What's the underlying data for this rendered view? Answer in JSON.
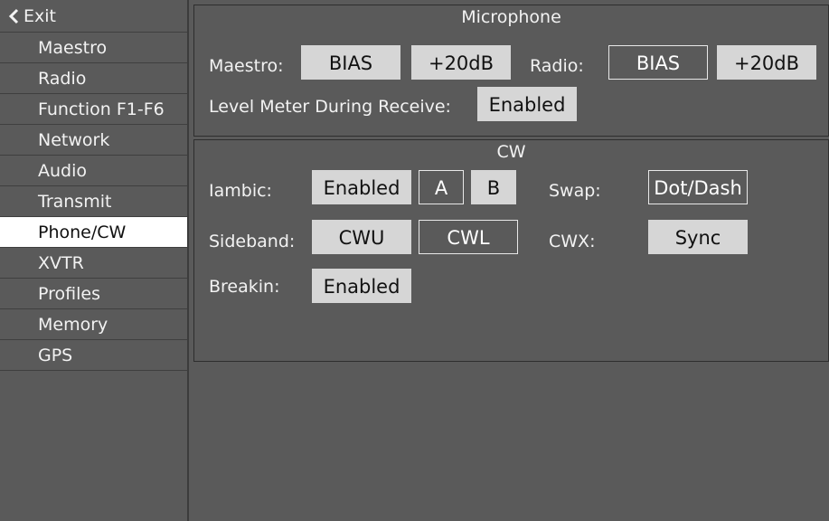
{
  "sidebar": {
    "exit_label": "Exit",
    "items": [
      {
        "label": "Maestro"
      },
      {
        "label": "Radio"
      },
      {
        "label": "Function F1-F6"
      },
      {
        "label": "Network"
      },
      {
        "label": "Audio"
      },
      {
        "label": "Transmit"
      },
      {
        "label": "Phone/CW"
      },
      {
        "label": "XVTR"
      },
      {
        "label": "Profiles"
      },
      {
        "label": "Memory"
      },
      {
        "label": "GPS"
      }
    ],
    "active": "Phone/CW"
  },
  "microphone": {
    "title": "Microphone",
    "maestro_label": "Maestro:",
    "maestro_bias": "BIAS",
    "maestro_boost": "+20dB",
    "radio_label": "Radio:",
    "radio_bias": "BIAS",
    "radio_boost": "+20dB",
    "level_meter_label": "Level Meter During Receive:",
    "level_meter_value": "Enabled"
  },
  "cw": {
    "title": "CW",
    "iambic_label": "Iambic:",
    "iambic_value": "Enabled",
    "iambic_mode_a": "A",
    "iambic_mode_b": "B",
    "swap_label": "Swap:",
    "swap_value": "Dot/Dash",
    "sideband_label": "Sideband:",
    "sideband_cwu": "CWU",
    "sideband_cwl": "CWL",
    "cwx_label": "CWX:",
    "cwx_value": "Sync",
    "breakin_label": "Breakin:",
    "breakin_value": "Enabled"
  },
  "colors": {
    "background": "#5a5a5a",
    "button_active": "#d6d6d6",
    "sidebar_active": "#ffffff"
  }
}
